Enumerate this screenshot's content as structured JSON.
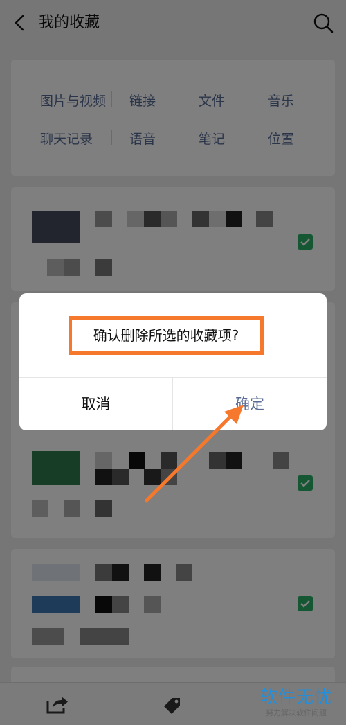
{
  "header": {
    "title": "我的收藏"
  },
  "filters": {
    "row1": [
      "图片与视频",
      "链接",
      "文件",
      "音乐"
    ],
    "row2": [
      "聊天记录",
      "语音",
      "笔记",
      "位置"
    ]
  },
  "dialog": {
    "message": "确认删除所选的收藏项?",
    "cancel_label": "取消",
    "confirm_label": "确定"
  },
  "watermark": {
    "main": "软件无忧",
    "sub": "努力解决软件问题"
  },
  "colors": {
    "link_blue": "#576b95",
    "check_green": "#2aae67",
    "highlight_orange": "#f5782c",
    "watermark_blue": "#1f8fde"
  },
  "icons": [
    "back-icon",
    "search-icon",
    "checkbox-checked-icon",
    "share-icon",
    "tag-icon"
  ]
}
